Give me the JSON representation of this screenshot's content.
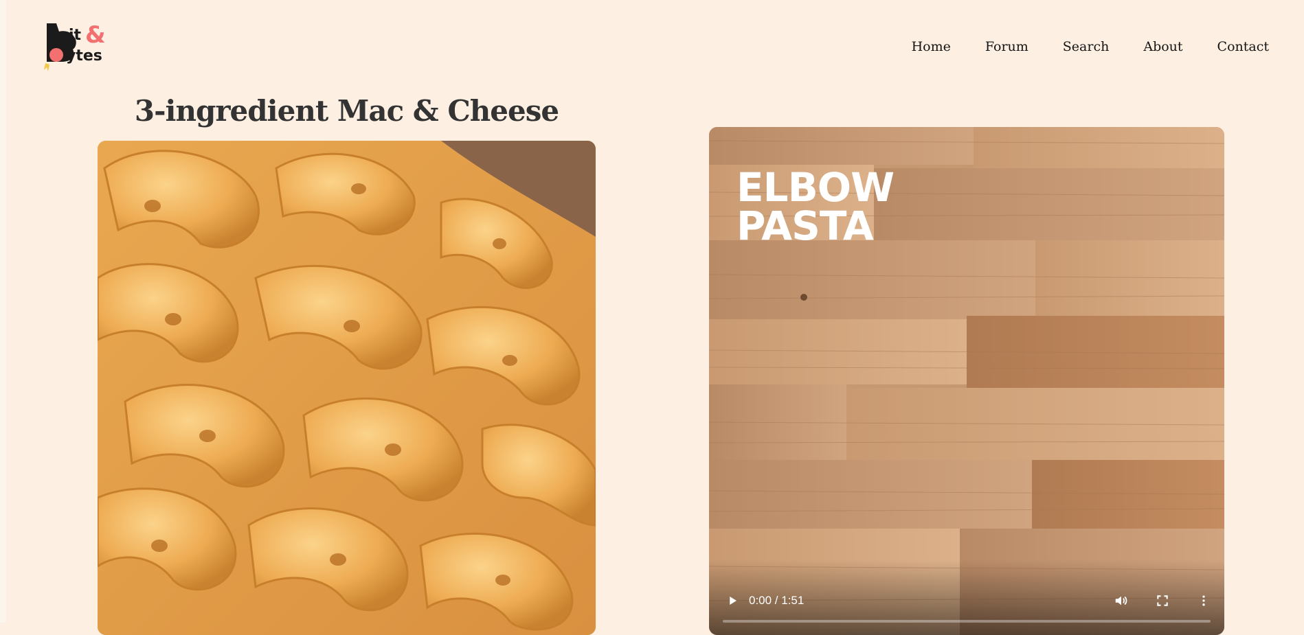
{
  "header": {
    "logo_text": "Bit & Bytes",
    "nav": [
      {
        "label": "Home"
      },
      {
        "label": "Forum"
      },
      {
        "label": "Search"
      },
      {
        "label": "About"
      },
      {
        "label": "Contact"
      }
    ]
  },
  "recipe": {
    "title": "3-ingredient Mac & Cheese"
  },
  "video": {
    "overlay_line1": "ELBOW",
    "overlay_line2": "PASTA",
    "time_display": "0:00 / 1:51",
    "progress": 0.0,
    "icons": {
      "play": "play-icon",
      "volume": "volume-icon",
      "fullscreen": "fullscreen-icon",
      "more": "more-vertical-icon"
    }
  },
  "colors": {
    "background": "#fdf0e3",
    "title": "#333333",
    "nav_text": "#141414",
    "logo_accent": "#f2706f"
  }
}
